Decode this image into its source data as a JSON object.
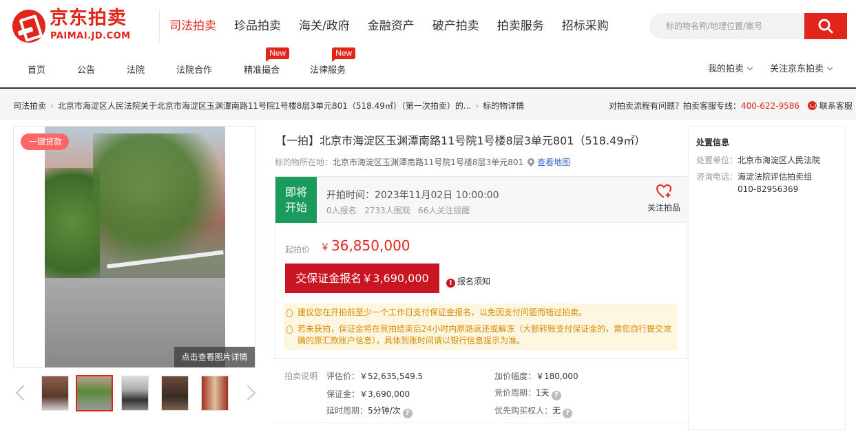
{
  "header": {
    "logo_cn": "京东拍卖",
    "logo_en": "PAIMAI.JD.COM",
    "nav": [
      "司法拍卖",
      "珍品拍卖",
      "海关/政府",
      "金融资产",
      "破产拍卖",
      "拍卖服务",
      "招标采购"
    ],
    "search_placeholder": "标的物名称/地理位置/案号",
    "subnav": [
      "首页",
      "公告",
      "法院",
      "法院合作",
      "精准撮合",
      "法律服务"
    ],
    "new_badge": "New",
    "my_auction": "我的拍卖",
    "follow": "关注京东拍卖"
  },
  "breadcrumb": {
    "root": "司法拍卖",
    "item": "北京市海淀区人民法院关于北京市海淀区玉渊潭南路11号院1号楼8层3单元801（518.49㎡）（第一次拍卖）的...",
    "current": "标的物详情",
    "help_prefix": "对拍卖流程有问题？拍卖客服专线：",
    "phone": "400-622-9586",
    "contact": "联系客服"
  },
  "gallery": {
    "loan_tag": "一键贷款",
    "caption": "点击查看图片详情"
  },
  "item": {
    "title": "【一拍】北京市海淀区玉渊潭南路11号院1号楼8层3单元801（518.49㎡）",
    "location_label": "标的物所在地：",
    "location": "北京市海淀区玉渊潭南路11号院1号楼8层3单元801",
    "map_link": "查看地图",
    "status_line1": "即将",
    "status_line2": "开始",
    "start_time": "开拍时间：2023年11月02日 10:00:00",
    "stats": "0人报名   2733人围观   66人关注提醒",
    "fav": "关注拍品",
    "price_label": "起拍价",
    "price_currency": "￥",
    "price": "36,850,000",
    "deposit_btn": "交保证金报名￥3,690,000",
    "notice": "报名须知",
    "tip1": "建议您在开拍前至少一个工作日支付保证金报名，以免因支付问题而错过拍卖。",
    "tip2": "若未获拍，保证金将在竞拍结束后24小时内原路返还或解冻（大额转账支付保证金的，需您自行提交准确的原汇款账户信息），具体到账时间请以银行信息提示为准。"
  },
  "details": {
    "section_label": "拍卖说明",
    "appraisal_label": "评估价：",
    "appraisal": "￥52,635,549.5",
    "increment_label": "加价幅度：",
    "increment": "￥180,000",
    "deposit_label": "保证金：",
    "deposit": "￥3,690,000",
    "cycle_label": "竞价周期：",
    "cycle": "1天",
    "delay_label": "延时周期：",
    "delay": "5分钟/次",
    "priority_label": "优先购买权人：",
    "priority": "无"
  },
  "side": {
    "title": "处置信息",
    "unit_label": "处置单位：",
    "unit": "北京市海淀区人民法院",
    "phone_label": "咨询电话：",
    "phone_name": "海淀法院评估拍卖组",
    "phone": "010-82956369"
  },
  "colors": {
    "brand_red": "#e1251b",
    "status_green": "#1a9a5c",
    "button_red": "#c81623"
  }
}
